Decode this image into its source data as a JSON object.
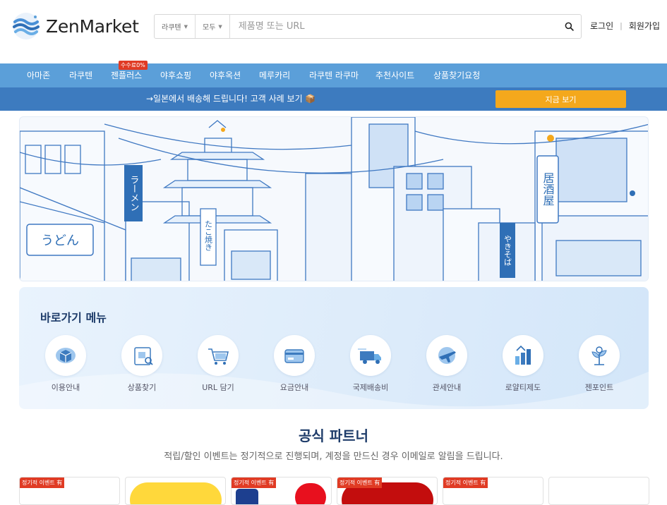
{
  "header": {
    "logo_text": "ZenMarket",
    "search": {
      "site_select": "라쿠텐",
      "category_select": "모두",
      "placeholder": "제품명 또는 URL",
      "value": ""
    },
    "auth": {
      "login": "로그인",
      "signup": "회원가입"
    }
  },
  "nav": {
    "items": [
      "아마존",
      "라쿠텐",
      "젠플러스",
      "야후쇼핑",
      "야후옥션",
      "메루카리",
      "라쿠텐 라쿠마",
      "추천사이트",
      "상품찾기요청"
    ],
    "badge": "수수료0%"
  },
  "promo": {
    "text": "→일본에서 배송해 드립니다! 고객 사례 보기 📦",
    "button": "지금 보기"
  },
  "banner": {
    "signs": [
      "ラーメン",
      "うどん",
      "たこ焼き",
      "居酒屋",
      "やきそば"
    ]
  },
  "shortcut": {
    "title": "바로가기 메뉴",
    "items": [
      {
        "label": "이용안내",
        "icon": "box-guide-icon"
      },
      {
        "label": "상품찾기",
        "icon": "product-search-icon"
      },
      {
        "label": "URL 담기",
        "icon": "cart-url-icon"
      },
      {
        "label": "요금안내",
        "icon": "payment-card-icon"
      },
      {
        "label": "국제배송비",
        "icon": "delivery-truck-icon"
      },
      {
        "label": "관세안내",
        "icon": "customs-plane-icon"
      },
      {
        "label": "로얄티제도",
        "icon": "loyalty-coins-icon"
      },
      {
        "label": "젠포인트",
        "icon": "zen-point-plant-icon"
      }
    ]
  },
  "partners": {
    "title": "공식 파트너",
    "subtitle": "적립/할인 이벤트는 정기적으로 진행되며, 계정을 만드신 경우 이메일로 알림을 드립니다.",
    "badge": "정기적 이벤트 有"
  },
  "colors": {
    "nav_bg": "#5b9fd9",
    "promo_bg": "#3d7bbf",
    "promo_button": "#f4a81c",
    "badge_red": "#e03b24",
    "title_navy": "#1e3c6a"
  }
}
